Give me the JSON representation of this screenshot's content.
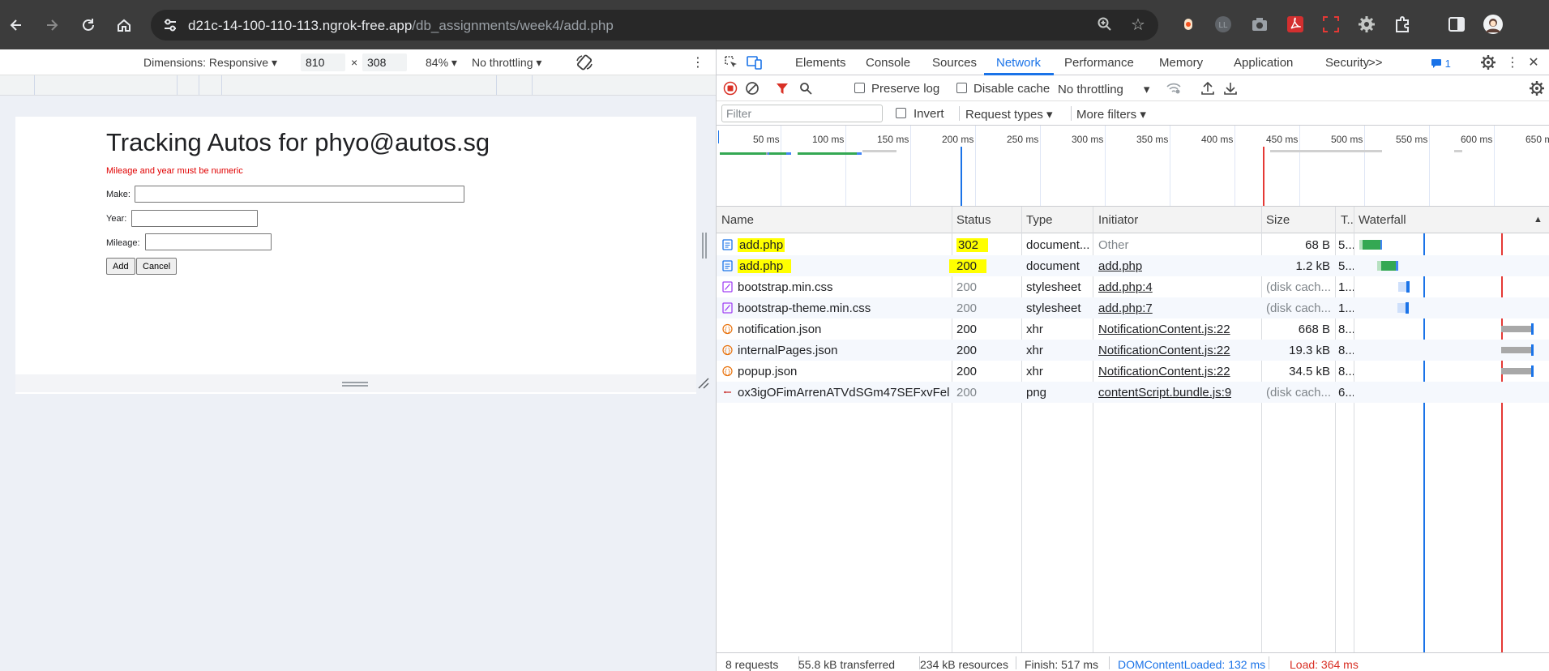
{
  "browser": {
    "url_host": "d21c-14-100-110-113.ngrok-free.app",
    "url_path": "/db_assignments/week4/add.php"
  },
  "device_toolbar": {
    "dimensions_label": "Dimensions: Responsive",
    "width": "810",
    "times": "×",
    "height": "308",
    "zoom": "84%",
    "throttling": "No throttling"
  },
  "page": {
    "title": "Tracking Autos for phyo@autos.sg",
    "error": "Mileage and year must be numeric",
    "make_label": "Make:",
    "year_label": "Year:",
    "mileage_label": "Mileage:",
    "add_button": "Add",
    "cancel_button": "Cancel"
  },
  "devtools": {
    "tabs": [
      "Elements",
      "Console",
      "Sources",
      "Network",
      "Performance",
      "Memory",
      "Application",
      "Security"
    ],
    "active_tab": "Network",
    "more_tabs": ">>",
    "issues_count": "1",
    "toolbar": {
      "preserve_log": "Preserve log",
      "disable_cache": "Disable cache",
      "throttling": "No throttling"
    },
    "filter_bar": {
      "filter_placeholder": "Filter",
      "invert": "Invert",
      "request_types": "Request types",
      "more_filters": "More filters"
    },
    "overview_ticks": [
      "50 ms",
      "100 ms",
      "150 ms",
      "200 ms",
      "250 ms",
      "300 ms",
      "350 ms",
      "400 ms",
      "450 ms",
      "500 ms",
      "550 ms",
      "600 ms",
      "650 m"
    ],
    "columns": {
      "name": "Name",
      "status": "Status",
      "type": "Type",
      "initiator": "Initiator",
      "size": "Size",
      "time": "T..",
      "waterfall": "Waterfall"
    },
    "requests": [
      {
        "name": "add.php",
        "status": "302",
        "type": "document...",
        "initiator": "Other",
        "size": "68 B",
        "time": "5..."
      },
      {
        "name": "add.php",
        "status": "200",
        "type": "document",
        "initiator": "add.php",
        "size": "1.2 kB",
        "time": "5..."
      },
      {
        "name": "bootstrap.min.css",
        "status": "200",
        "type": "stylesheet",
        "initiator": "add.php:4",
        "size": "(disk cach...",
        "time": "1..."
      },
      {
        "name": "bootstrap-theme.min.css",
        "status": "200",
        "type": "stylesheet",
        "initiator": "add.php:7",
        "size": "(disk cach...",
        "time": "1..."
      },
      {
        "name": "notification.json",
        "status": "200",
        "type": "xhr",
        "initiator": "NotificationContent.js:22",
        "size": "668 B",
        "time": "8..."
      },
      {
        "name": "internalPages.json",
        "status": "200",
        "type": "xhr",
        "initiator": "NotificationContent.js:22",
        "size": "19.3 kB",
        "time": "8..."
      },
      {
        "name": "popup.json",
        "status": "200",
        "type": "xhr",
        "initiator": "NotificationContent.js:22",
        "size": "34.5 kB",
        "time": "8..."
      },
      {
        "name": "ox3igOFimArrenATVdSGm47SEFxvFel...",
        "status": "200",
        "type": "png",
        "initiator": "contentScript.bundle.js:9",
        "size": "(disk cach...",
        "time": "6..."
      }
    ],
    "status_bar": {
      "requests": "8 requests",
      "transferred": "55.8 kB transferred",
      "resources": "234 kB resources",
      "finish": "Finish: 517 ms",
      "dom_content_loaded": "DOMContentLoaded: 132 ms",
      "load": "Load: 364 ms"
    },
    "colors": {
      "accent": "#1a73e8",
      "highlight": "#ffff00",
      "load_line": "#e53935",
      "dcl_line": "#1a73e8"
    }
  }
}
